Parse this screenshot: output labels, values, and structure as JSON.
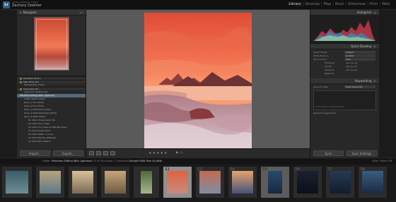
{
  "identity": {
    "logo_text": "Lr",
    "subtitle": "Adobe Lightroom Classic",
    "name": "Zachary Doehler"
  },
  "modules": [
    "Library",
    "Develop",
    "Map",
    "Book",
    "Slideshow",
    "Print",
    "Web"
  ],
  "active_module": "Library",
  "left_panel": {
    "navigator_label": "Navigator",
    "navigator_zoom": "FIT",
    "rows": [
      {
        "label": "Windows 10 (C:)",
        "count": "",
        "type": "cat"
      },
      {
        "label": "Main Book (D:)",
        "count": "",
        "type": "cat"
      },
      {
        "label": "Photography Folder",
        "count": "",
        "type": "row"
      },
      {
        "label": "Secondary (E:)",
        "count": "",
        "type": "cat"
      },
      {
        "label": "Lightroom Masterclass",
        "count": "",
        "type": "row"
      },
      {
        "label": "Effortless Editing With Lightroom",
        "count": "",
        "type": "sel"
      },
      {
        "label": "Coffee Retail (2022)",
        "count": "",
        "type": "row"
      },
      {
        "label": "Kevin_1 Pre (2022)",
        "count": "",
        "type": "row"
      },
      {
        "label": "Kevin_2 Pre (2022)",
        "count": "",
        "type": "row"
      },
      {
        "label": "Kevin_3 Refreshed (2022)",
        "count": "",
        "type": "row"
      },
      {
        "label": "Kevin_4 RAW Refreshed (2022)",
        "count": "",
        "type": "row"
      },
      {
        "label": "Kevin_4 RAW (2022)",
        "count": "",
        "type": "row"
      },
      {
        "label": "K1 2022 Homemaker Tile",
        "count": "",
        "type": "row"
      },
      {
        "label": "K4 2021 Fancy Lake",
        "count": "",
        "type": "row"
      },
      {
        "label": "K4 2021 Cool Lake & Little Mountain",
        "count": "",
        "type": "row"
      },
      {
        "label": "K3 2021 Purple Pinks",
        "count": "",
        "type": "row"
      },
      {
        "label": "K4 2021 Water + Lucas",
        "count": "",
        "type": "row"
      },
      {
        "label": "K3 2021 BW Sky Waterfall",
        "count": "",
        "type": "row"
      },
      {
        "label": "K3 2021 Bikini Beach",
        "count": "",
        "type": "row"
      }
    ],
    "import_label": "Import...",
    "export_label": "Export..."
  },
  "right_panel": {
    "histogram_label": "Histogram",
    "quick_develop_label": "Quick Develop",
    "quick_develop_rows": [
      {
        "label": "Saved Preset",
        "value": "Custom"
      },
      {
        "label": "White Balance",
        "value": "As Shot"
      },
      {
        "label": "Tone Control",
        "value": "Auto"
      },
      {
        "label": "Exposure",
        "value": ""
      },
      {
        "label": "Clarity",
        "value": ""
      },
      {
        "label": "Vibrance",
        "value": ""
      },
      {
        "label": "Reset All",
        "value": ""
      }
    ],
    "keywording_label": "Keywording",
    "keyword_tags_label": "Keyword Tags",
    "keyword_tags_value": "Enter Keywords",
    "keyword_hint": "Click here to add keywords",
    "keyword_suggestions_label": "Keyword Suggestions",
    "sync_label": "Sync",
    "sync_settings_label": "Sync Settings"
  },
  "filmstrip": {
    "path_prefix": "Folder:",
    "path": "Effortless Editing With Lightroom",
    "count": "37 of 38 photos / 1 selected",
    "file": "/Sample RAW Files 04.ARW",
    "filter_label": "Filter:",
    "filter_value": "Filters Off",
    "thumbs": [
      {
        "num": "",
        "state": "normal",
        "c1": "#3a5d6a",
        "c2": "#6f8c93",
        "tall": false
      },
      {
        "num": "",
        "state": "normal",
        "c1": "#b9a27f",
        "c2": "#5b7a86",
        "tall": false
      },
      {
        "num": "",
        "state": "normal",
        "c1": "#d9c09a",
        "c2": "#7a6a55",
        "tall": false
      },
      {
        "num": "",
        "state": "normal",
        "c1": "#c7a57a",
        "c2": "#6e5a43",
        "tall": false
      },
      {
        "num": "",
        "state": "normal",
        "c1": "#4e6b3a",
        "c2": "#a9b58f",
        "tall": true
      },
      {
        "num": "22",
        "state": "sel",
        "c1": "#e0623f",
        "c2": "#c68a80",
        "tall": false
      },
      {
        "num": "23",
        "state": "normal",
        "c1": "#c46a52",
        "c2": "#7f8da3",
        "tall": false
      },
      {
        "num": "24",
        "state": "normal",
        "c1": "#e7a36b",
        "c2": "#44527a",
        "tall": false
      },
      {
        "num": "25",
        "state": "sub",
        "c1": "#284a6b",
        "c2": "#162a40",
        "tall": true
      },
      {
        "num": "26",
        "state": "normal",
        "c1": "#1a2230",
        "c2": "#0b1018",
        "tall": false
      },
      {
        "num": "27",
        "state": "normal",
        "c1": "#263a55",
        "c2": "#111d2b",
        "tall": false
      },
      {
        "num": "28",
        "state": "normal",
        "c1": "#3b5d80",
        "c2": "#1b2b40",
        "tall": false
      }
    ]
  },
  "toolbar": {
    "stars": "★★★★★",
    "flags": "⚑ ⚐"
  }
}
